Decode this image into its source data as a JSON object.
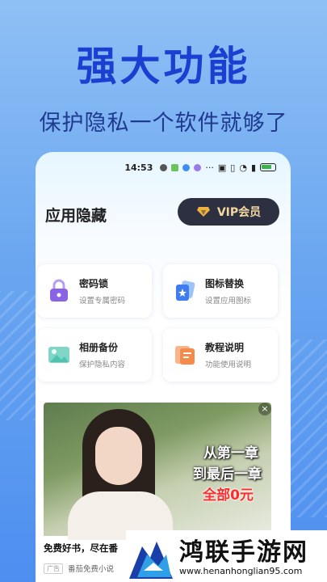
{
  "promo": {
    "headline": "强大功能",
    "subline": "保护隐私一个软件就够了"
  },
  "status_bar": {
    "time": "14:53",
    "battery_color": "#3bb34a"
  },
  "app": {
    "title": "应用隐藏",
    "vip_label": "VIP会员",
    "features": [
      {
        "title": "密码锁",
        "desc": "设置专属密码",
        "icon": "lock-icon",
        "color": "#8a62e6"
      },
      {
        "title": "图标替换",
        "desc": "设置应用图标",
        "icon": "icon-swap-icon",
        "color": "#3e7cf0"
      },
      {
        "title": "相册备份",
        "desc": "保护隐私内容",
        "icon": "photo-icon",
        "color": "#4fc3b0"
      },
      {
        "title": "教程说明",
        "desc": "功能使用说明",
        "icon": "document-icon",
        "color": "#f58a4a"
      }
    ]
  },
  "ad": {
    "line1": "从第一章",
    "line2": "到最后一章",
    "line3": "全部0元",
    "close": "×",
    "headline": "免费好书，尽在番",
    "badge": "广告",
    "source": "番茄免费小说"
  },
  "watermark": {
    "name": "鸿联手游网",
    "url": "www.henanhonglian95.com"
  },
  "colors": {
    "headline": "#1a3fd1",
    "vip_bg": "#2d3040",
    "vip_text": "#f5d7a0"
  }
}
